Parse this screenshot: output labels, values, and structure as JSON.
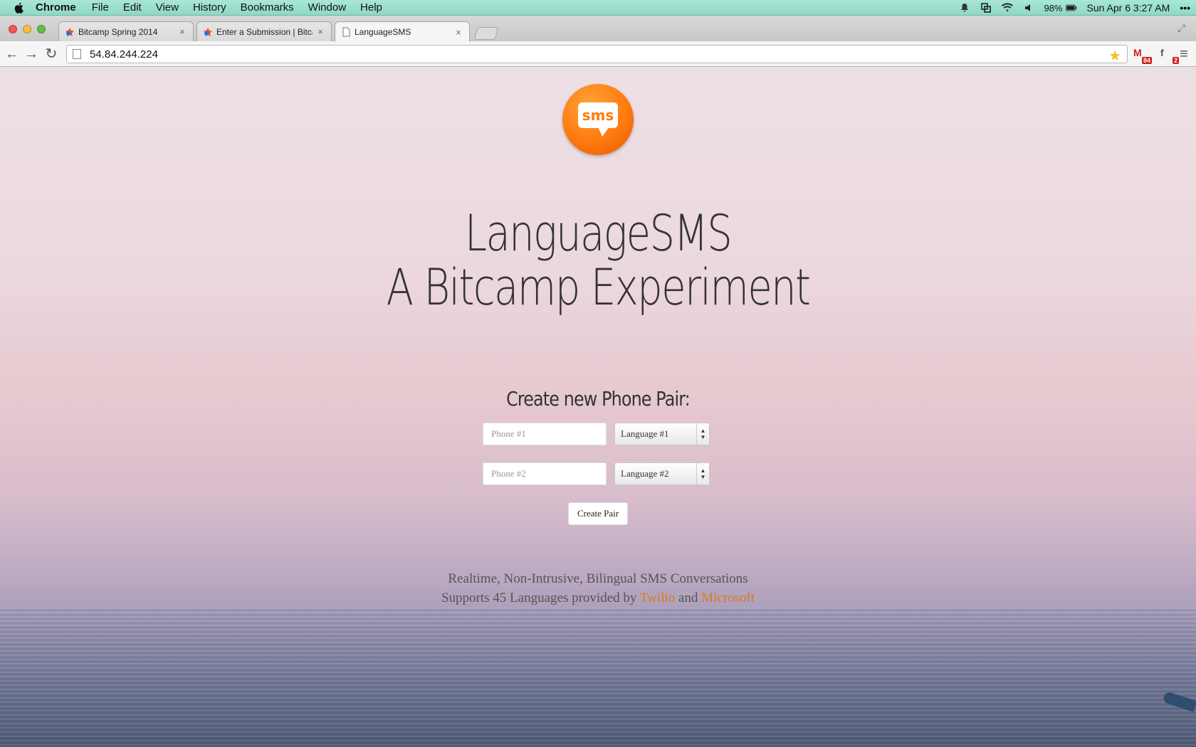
{
  "menubar": {
    "app_name": "Chrome",
    "menus": [
      "File",
      "Edit",
      "View",
      "History",
      "Bookmarks",
      "Window",
      "Help"
    ],
    "battery": "98%",
    "datetime": "Sun Apr 6  3:27 AM"
  },
  "tabs": [
    {
      "title": "Bitcamp Spring 2014",
      "close": "×"
    },
    {
      "title": "Enter a Submission | Bitcamp",
      "close": "×"
    },
    {
      "title": "LanguageSMS",
      "close": "×"
    }
  ],
  "toolbar": {
    "url": "54.84.244.224",
    "gmail_badge": "84",
    "facebook_badge": "2"
  },
  "page": {
    "logo_text": "sms",
    "title_line1": "LanguageSMS",
    "title_line2": "A Bitcamp Experiment",
    "form_heading": "Create new Phone Pair:",
    "phone1_placeholder": "Phone #1",
    "phone2_placeholder": "Phone #2",
    "language1": "Language #1",
    "language2": "Language #2",
    "submit_label": "Create Pair",
    "tagline1": "Realtime, Non-Intrusive, Bilingual SMS Conversations",
    "tagline2_prefix": "Supports 45 Languages provided by",
    "link_twilio": "Twilio",
    "tagline2_and": "and",
    "link_microsoft": "Microsoft"
  },
  "colors": {
    "accent_orange": "#ff7a0e",
    "link": "#d97b1c"
  }
}
